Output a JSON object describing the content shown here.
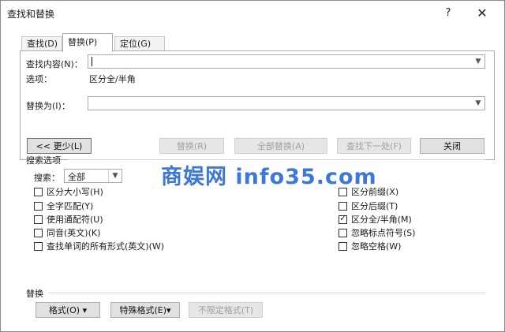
{
  "window": {
    "title": "查找和替换",
    "help": "?",
    "close": "✕"
  },
  "tabs": [
    {
      "label": "查找(D)"
    },
    {
      "label": "替换(P)"
    },
    {
      "label": "定位(G)"
    }
  ],
  "find": {
    "label": "查找内容(N)：",
    "value": ""
  },
  "options": {
    "label": "选项：",
    "value": "区分全/半角"
  },
  "replace_with": {
    "label": "替换为(I)：",
    "value": ""
  },
  "buttons": {
    "less": "<< 更少(L)",
    "replace": "替换(R)",
    "replace_all": "全部替换(A)",
    "find_next": "查找下一处(F)",
    "close": "关闭"
  },
  "search_options": {
    "title": "搜索选项",
    "search_label": "搜索：",
    "search_value": "全部",
    "left_checks": [
      {
        "label": "区分大小写(H)",
        "checked": false
      },
      {
        "label": "全字匹配(Y)",
        "checked": false
      },
      {
        "label": "使用通配符(U)",
        "checked": false
      },
      {
        "label": "同音(英文)(K)",
        "checked": false
      },
      {
        "label": "查找单词的所有形式(英文)(W)",
        "checked": false
      }
    ],
    "right_checks": [
      {
        "label": "区分前缀(X)",
        "checked": false
      },
      {
        "label": "区分后缀(T)",
        "checked": false
      },
      {
        "label": "区分全/半角(M)",
        "checked": true
      },
      {
        "label": "忽略标点符号(S)",
        "checked": false
      },
      {
        "label": "忽略空格(W)",
        "checked": false
      }
    ]
  },
  "replace_section": {
    "title": "替换",
    "format": "格式(O) ▾",
    "special": "特殊格式(E)▾",
    "no_format": "不限定格式(T)"
  },
  "watermark": "商娱网 info35.com"
}
